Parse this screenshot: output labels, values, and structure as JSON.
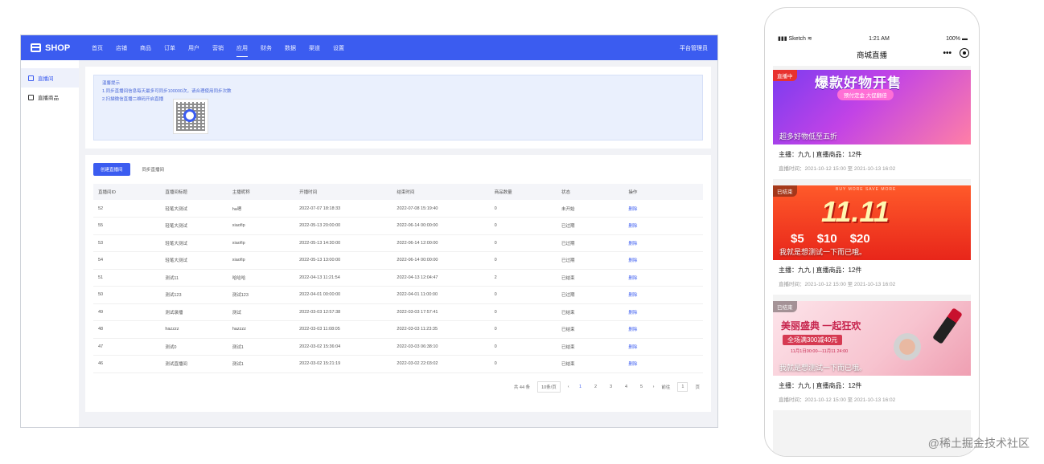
{
  "admin": {
    "logo": "SHOP",
    "nav": [
      "首页",
      "店铺",
      "商品",
      "订单",
      "用户",
      "营销",
      "应用",
      "财务",
      "数据",
      "渠道",
      "设置"
    ],
    "nav_active_index": 6,
    "user": "平台管理员",
    "sidebar": [
      {
        "label": "直播间",
        "active": true
      },
      {
        "label": "直播商品",
        "active": false
      }
    ],
    "notice": {
      "title": "温馨提示",
      "line1": "1.同步直播间信息每天最多可同步100000次，请合理使用同步次数",
      "line2": "2.扫描微信直播二维码开启直播"
    },
    "tabs": [
      "创建直播间",
      "同步直播间"
    ],
    "table": {
      "headers": [
        "直播间ID",
        "直播间标题",
        "主播昵称",
        "开播时间",
        "结束时间",
        "商品数量",
        "状态",
        "操作"
      ],
      "rows": [
        [
          "52",
          "轻笔大测试",
          "ha嗯",
          "2022-07-07 18:18:33",
          "2022-07-08 15:19:40",
          "0",
          "未开始",
          "删除"
        ],
        [
          "55",
          "轻笔大测试",
          "xiaofip",
          "2022-05-13 20:00:00",
          "2022-06-14 00:00:00",
          "0",
          "已过期",
          "删除"
        ],
        [
          "53",
          "轻笔大测试",
          "xiaofip",
          "2022-05-13 14:30:00",
          "2022-06-14 12:00:00",
          "0",
          "已过期",
          "删除"
        ],
        [
          "54",
          "轻笔大测试",
          "xiaofip",
          "2022-05-13 13:00:00",
          "2022-06-14 00:00:00",
          "0",
          "已过期",
          "删除"
        ],
        [
          "51",
          "测试11",
          "哈哈哈",
          "2022-04-13 11:21:54",
          "2022-04-13 12:04:47",
          "2",
          "已结束",
          "删除"
        ],
        [
          "50",
          "测试123",
          "测试123",
          "2022-04-01 00:00:00",
          "2022-04-01 11:00:00",
          "0",
          "已过期",
          "删除"
        ],
        [
          "49",
          "测试录播",
          "测试",
          "2022-03-03 12:57:38",
          "2022-03-03 17:57:41",
          "0",
          "已结束",
          "删除"
        ],
        [
          "48",
          "hazzzz",
          "hazzzz",
          "2022-03-03 11:08:05",
          "2022-03-03 11:23:35",
          "0",
          "已结束",
          "删除"
        ],
        [
          "47",
          "测试0",
          "测试1",
          "2022-03-02 15:36:04",
          "2022-03-03 06:38:10",
          "0",
          "已结束",
          "删除"
        ],
        [
          "46",
          "测试直播间",
          "测试1",
          "2022-03-02 15:21:19",
          "2022-03-02 22:03:02",
          "0",
          "已结束",
          "删除"
        ]
      ]
    },
    "pager": {
      "total": "共 44 条",
      "page_size": "10条/页",
      "prev": "‹",
      "pages": [
        "1",
        "2",
        "3",
        "4",
        "5"
      ],
      "next": "›",
      "goto": "前往",
      "goto_value": "1",
      "page_unit": "页"
    }
  },
  "phone": {
    "carrier": "Sketch",
    "time": "1:21 AM",
    "battery": "100%",
    "title": "商城直播",
    "menu_dots": "•••",
    "cards": [
      {
        "tag": "直播中",
        "banner_title": "爆款好物开售",
        "banner_pill": "预付定金 大促翻倍",
        "banner_caption": "超多好物低至五折",
        "host": "主播：九九 | 直播商品：12件",
        "time": "直播时间：2021-10-12 15:00 至 2021-10-13 16:02"
      },
      {
        "tag": "已结束",
        "banner_sub": "BUY MORE SAVE MORE",
        "banner_title": "11.11",
        "coupons": [
          "$5",
          "$10",
          "$20"
        ],
        "banner_caption": "我就是想测试一下而已哦。",
        "host": "主播：九九 | 直播商品：12件",
        "time": "直播时间：2021-10-12 15:00 至 2021-10-13 16:02"
      },
      {
        "tag": "已结束",
        "banner_title": "美丽盛典 一起狂欢",
        "banner_pill": "全场满300减40元",
        "banner_date": "11月1日00:00—11月11 24:00",
        "banner_caption": "我就是想测试一下而已哦。",
        "host": "主播：九九 | 直播商品：12件",
        "time": "直播时间：2021-10-12 15:00 至 2021-10-13 16:02"
      }
    ]
  },
  "credit": "@稀土掘金技术社区",
  "colors": {
    "primary": "#3b5cf0",
    "live": "#e8322f"
  }
}
